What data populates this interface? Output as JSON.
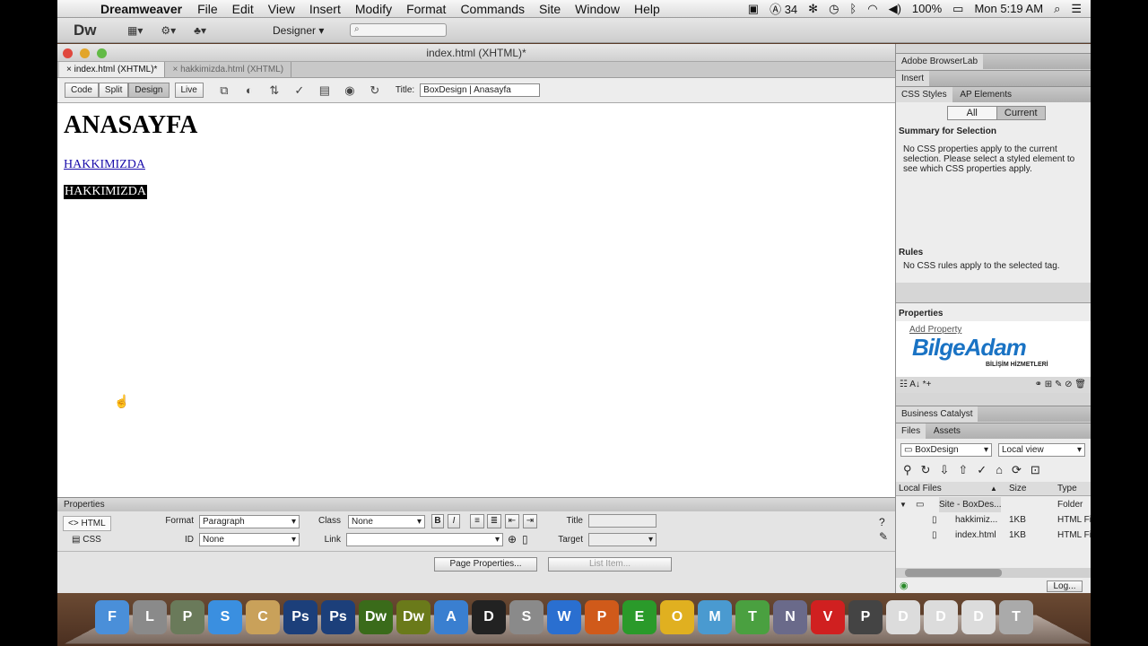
{
  "menubar": {
    "app_name": "Dreamweaver",
    "items": [
      "File",
      "Edit",
      "View",
      "Insert",
      "Modify",
      "Format",
      "Commands",
      "Site",
      "Window",
      "Help"
    ],
    "status_battery_label": "34",
    "battery": "100%",
    "clock": "Mon 5:19 AM"
  },
  "app_toolbar": {
    "logo": "Dw",
    "workspace": "Designer"
  },
  "document": {
    "window_title": "index.html (XHTML)*",
    "tabs": [
      {
        "label": "index.html (XHTML)*",
        "active": true
      },
      {
        "label": "hakkimizda.html (XHTML)",
        "active": false
      }
    ],
    "view_buttons": [
      "Code",
      "Split",
      "Design",
      "Live"
    ],
    "selected_view": "Design",
    "title_label": "Title:",
    "title_value": "BoxDesign | Anasayfa",
    "content": {
      "heading": "ANASAYFA",
      "link": "HAKKIMIZDA",
      "selected_text": "HAKKIMIZDA"
    }
  },
  "properties": {
    "header": "Properties",
    "mode_html": "HTML",
    "mode_css": "CSS",
    "format_label": "Format",
    "format_value": "Paragraph",
    "id_label": "ID",
    "id_value": "None",
    "class_label": "Class",
    "class_value": "None",
    "link_label": "Link",
    "title_label": "Title",
    "target_label": "Target",
    "bold": "B",
    "italic": "I",
    "page_properties_btn": "Page Properties...",
    "list_item_btn": "List Item..."
  },
  "panels": {
    "browserlab": "Adobe BrowserLab",
    "insert": "Insert",
    "css_styles_tab": "CSS Styles",
    "ap_elements_tab": "AP Elements",
    "all_btn": "All",
    "current_btn": "Current",
    "summary_title": "Summary for Selection",
    "summary_text": "No CSS properties apply to the current selection.  Please select a styled element to see which CSS properties apply.",
    "rules_title": "Rules",
    "rules_text": "No CSS rules apply to the selected tag.",
    "props_title": "Properties",
    "add_property": "Add Property",
    "watermark_main": "BilgeAdam",
    "watermark_sub": "BİLİŞİM HİZMETLERİ",
    "business_catalyst": "Business Catalyst",
    "files_tab": "Files",
    "assets_tab": "Assets",
    "site_select": "BoxDesign",
    "view_select": "Local view",
    "col_local": "Local Files",
    "col_size": "Size",
    "col_type": "Type",
    "files": [
      {
        "name": "Site - BoxDes...",
        "size": "",
        "type": "Folder"
      },
      {
        "name": "hakkimiz...",
        "size": "1KB",
        "type": "HTML Fi"
      },
      {
        "name": "index.html",
        "size": "1KB",
        "type": "HTML Fi"
      }
    ],
    "log_btn": "Log..."
  },
  "dock": {
    "apps": [
      "Finder",
      "Launchpad",
      "Preview",
      "Safari",
      "Contacts",
      "Ps",
      "Ps",
      "Dw",
      "Dw",
      "App Store",
      "Dashboard",
      "System Preferences",
      "Word",
      "PowerPoint",
      "Excel",
      "Outlook",
      "Messenger",
      "Transmit",
      "Network",
      "Vodafone",
      "Photo Booth",
      "Documents",
      "Desktop",
      "Downloads",
      "Trash"
    ],
    "colors": [
      "#4a8fd9",
      "#8a8a8a",
      "#6a7a5a",
      "#3a8fe0",
      "#c9a15a",
      "#1c3f7a",
      "#1c3f7a",
      "#3a6b1a",
      "#6a7a1a",
      "#3a7fd0",
      "#222222",
      "#8a8a8a",
      "#2a6fd0",
      "#d05a1a",
      "#2a9a2a",
      "#e0b020",
      "#4a9ad0",
      "#4aa040",
      "#6a6a8a",
      "#d02020",
      "#444444",
      "#dcdcdc",
      "#dcdcdc",
      "#dcdcdc",
      "#aaaaaa"
    ]
  }
}
